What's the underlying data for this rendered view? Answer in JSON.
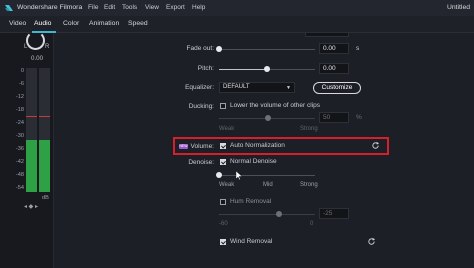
{
  "titlebar": {
    "app_name": "Wondershare Filmora",
    "menu": [
      "File",
      "Edit",
      "Tools",
      "View",
      "Export",
      "Help"
    ],
    "window_title": "Untitled"
  },
  "tabs": [
    "Video",
    "Audio",
    "Color",
    "Animation",
    "Speed"
  ],
  "active_tab": "Audio",
  "meter": {
    "left_label": "L",
    "right_label": "R",
    "value": "0.00",
    "scale": [
      "0",
      "-6",
      "-12",
      "-18",
      "-24",
      "-30",
      "-36",
      "-42",
      "-48",
      "-54"
    ],
    "unit": "dB"
  },
  "fade_out": {
    "label": "Fade out:",
    "value": "0.00",
    "unit": "s"
  },
  "pitch": {
    "label": "Pitch:",
    "value": "0.00"
  },
  "equalizer": {
    "label": "Equalizer:",
    "value": "DEFAULT",
    "button": "Customize"
  },
  "ducking": {
    "label": "Ducking:",
    "checkbox_label": "Lower the volume of other clips",
    "value": "50",
    "unit": "%",
    "ticks": [
      "Weak",
      "Strong"
    ]
  },
  "volume": {
    "badge": "NEW",
    "label": "Volume:",
    "checkbox_label": "Auto Normalization"
  },
  "denoise": {
    "label": "Denoise:",
    "normal_label": "Normal Denoise",
    "ticks": [
      "Weak",
      "Mid",
      "Strong"
    ],
    "hum_label": "Hum Removal",
    "hum_value": "-25",
    "hum_ticks": [
      "-60",
      "0"
    ],
    "wind_label": "Wind Removal"
  },
  "colors": {
    "accent": "#3fb8cf",
    "highlight": "#d4202a",
    "meter_green": "#2ea045"
  }
}
